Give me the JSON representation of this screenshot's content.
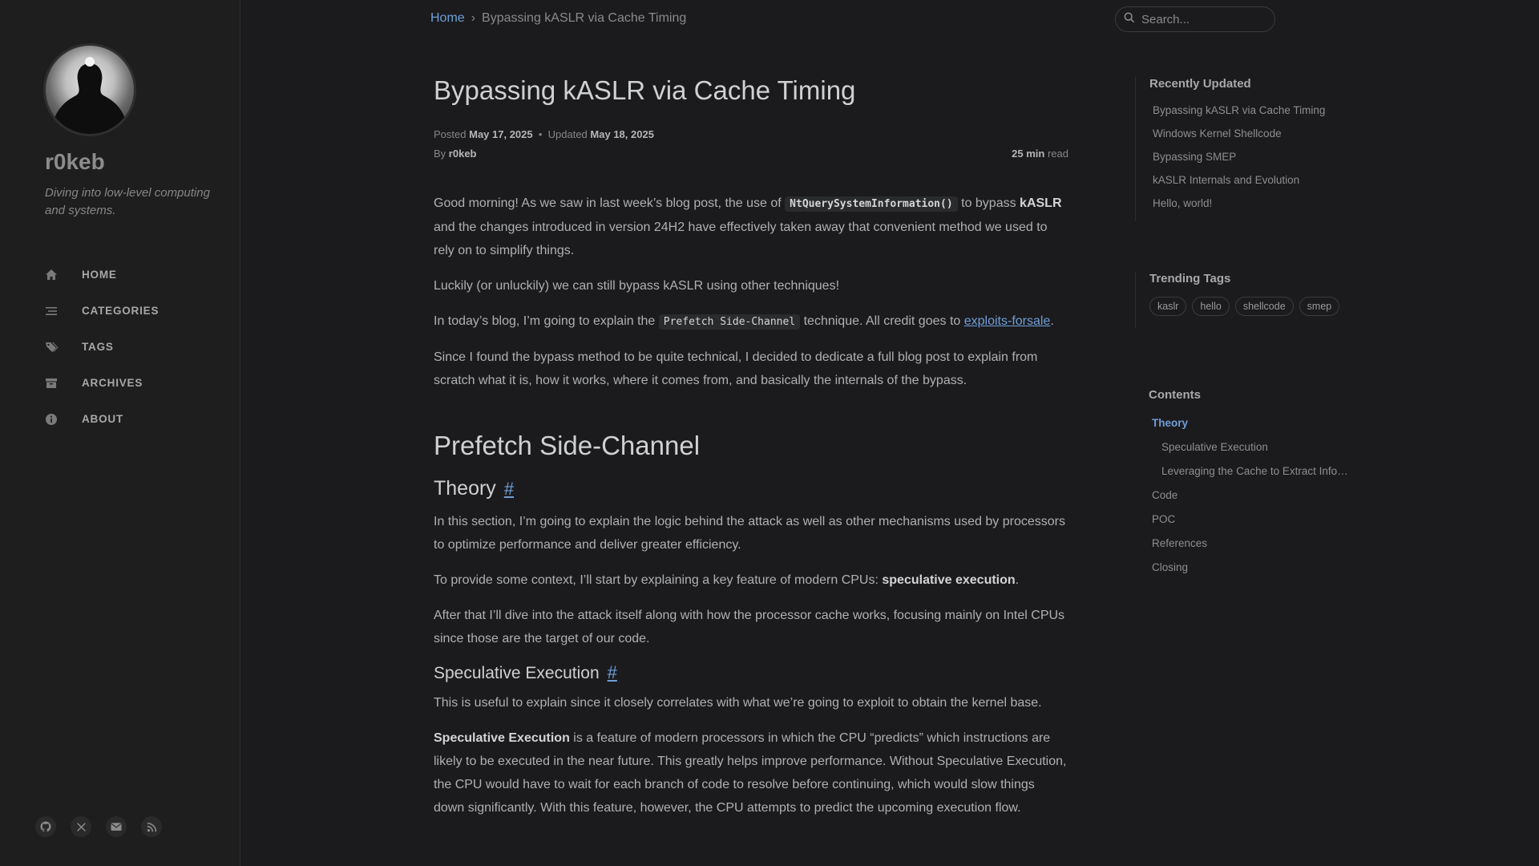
{
  "site": {
    "title": "r0keb",
    "subtitle": "Diving into low-level computing and systems."
  },
  "nav": [
    {
      "label": "HOME",
      "icon": "home-icon"
    },
    {
      "label": "CATEGORIES",
      "icon": "list-icon"
    },
    {
      "label": "TAGS",
      "icon": "tags-icon"
    },
    {
      "label": "ARCHIVES",
      "icon": "archive-icon"
    },
    {
      "label": "ABOUT",
      "icon": "info-icon"
    }
  ],
  "social": [
    "github-icon",
    "x-icon",
    "email-icon",
    "rss-icon"
  ],
  "breadcrumb": {
    "home": "Home",
    "sep": "›",
    "current": "Bypassing kASLR via Cache Timing"
  },
  "search": {
    "placeholder": "Search..."
  },
  "post": {
    "title": "Bypassing kASLR via Cache Timing",
    "posted_label": "Posted",
    "posted": "May 17, 2025",
    "updated_label": "Updated",
    "updated": "May 18, 2025",
    "by_label": "By",
    "author": "r0keb",
    "read_min": "25 min",
    "read_label": "read"
  },
  "content": {
    "p1_a": "Good morning! As we saw in last week’s blog post, the use of ",
    "p1_code": "NtQuerySystemInformation()",
    "p1_b": " to bypass ",
    "p1_bold": "kASLR",
    "p1_c": " and the changes introduced in version 24H2 have effectively taken away that convenient method we used to rely on to simplify things.",
    "p2": "Luckily (or unluckily) we can still bypass kASLR using other techniques!",
    "p3_a": "In today’s blog, I’m going to explain the ",
    "p3_code": "Prefetch Side-Channel",
    "p3_b": " technique. All credit goes to ",
    "p3_link": "exploits-forsale",
    "p3_c": ".",
    "p4": "Since I found the bypass method to be quite technical, I decided to dedicate a full blog post to explain from scratch what it is, how it works, where it comes from, and basically the internals of the bypass.",
    "h2": "Prefetch Side-Channel",
    "h3": "Theory",
    "anchor": "#",
    "p5": "In this section, I’m going to explain the logic behind the attack as well as other mechanisms used by processors to optimize performance and deliver greater efficiency.",
    "p6_a": "To provide some context, I’ll start by explaining a key feature of modern CPUs: ",
    "p6_bold": "speculative execution",
    "p6_b": ".",
    "p7": "After that I’ll dive into the attack itself along with how the processor cache works, focusing mainly on Intel CPUs since those are the target of our code.",
    "h4": "Speculative Execution",
    "p8": "This is useful to explain since it closely correlates with what we’re going to exploit to obtain the kernel base.",
    "p9_bold": "Speculative Execution",
    "p9": " is a feature of modern processors in which the CPU “predicts” which instructions are likely to be executed in the near future. This greatly helps improve performance. Without Speculative Execution, the CPU would have to wait for each branch of code to resolve before continuing, which would slow things down significantly. With this feature, however, the CPU attempts to predict the upcoming execution flow."
  },
  "recent": {
    "title": "Recently Updated",
    "items": [
      "Bypassing kASLR via Cache Timing",
      "Windows Kernel Shellcode",
      "Bypassing SMEP",
      "kASLR Internals and Evolution",
      "Hello, world!"
    ]
  },
  "tags": {
    "title": "Trending Tags",
    "items": [
      "kaslr",
      "hello",
      "shellcode",
      "smep"
    ]
  },
  "toc": {
    "title": "Contents",
    "items": [
      "Theory",
      "Speculative Execution",
      "Leveraging the Cache to Extract Infor…",
      "Code",
      "POC",
      "References",
      "Closing"
    ]
  },
  "colors": {
    "background": "#1b1b1e",
    "sidebar": "#1e1e1e",
    "link": "#6f9fd8"
  }
}
